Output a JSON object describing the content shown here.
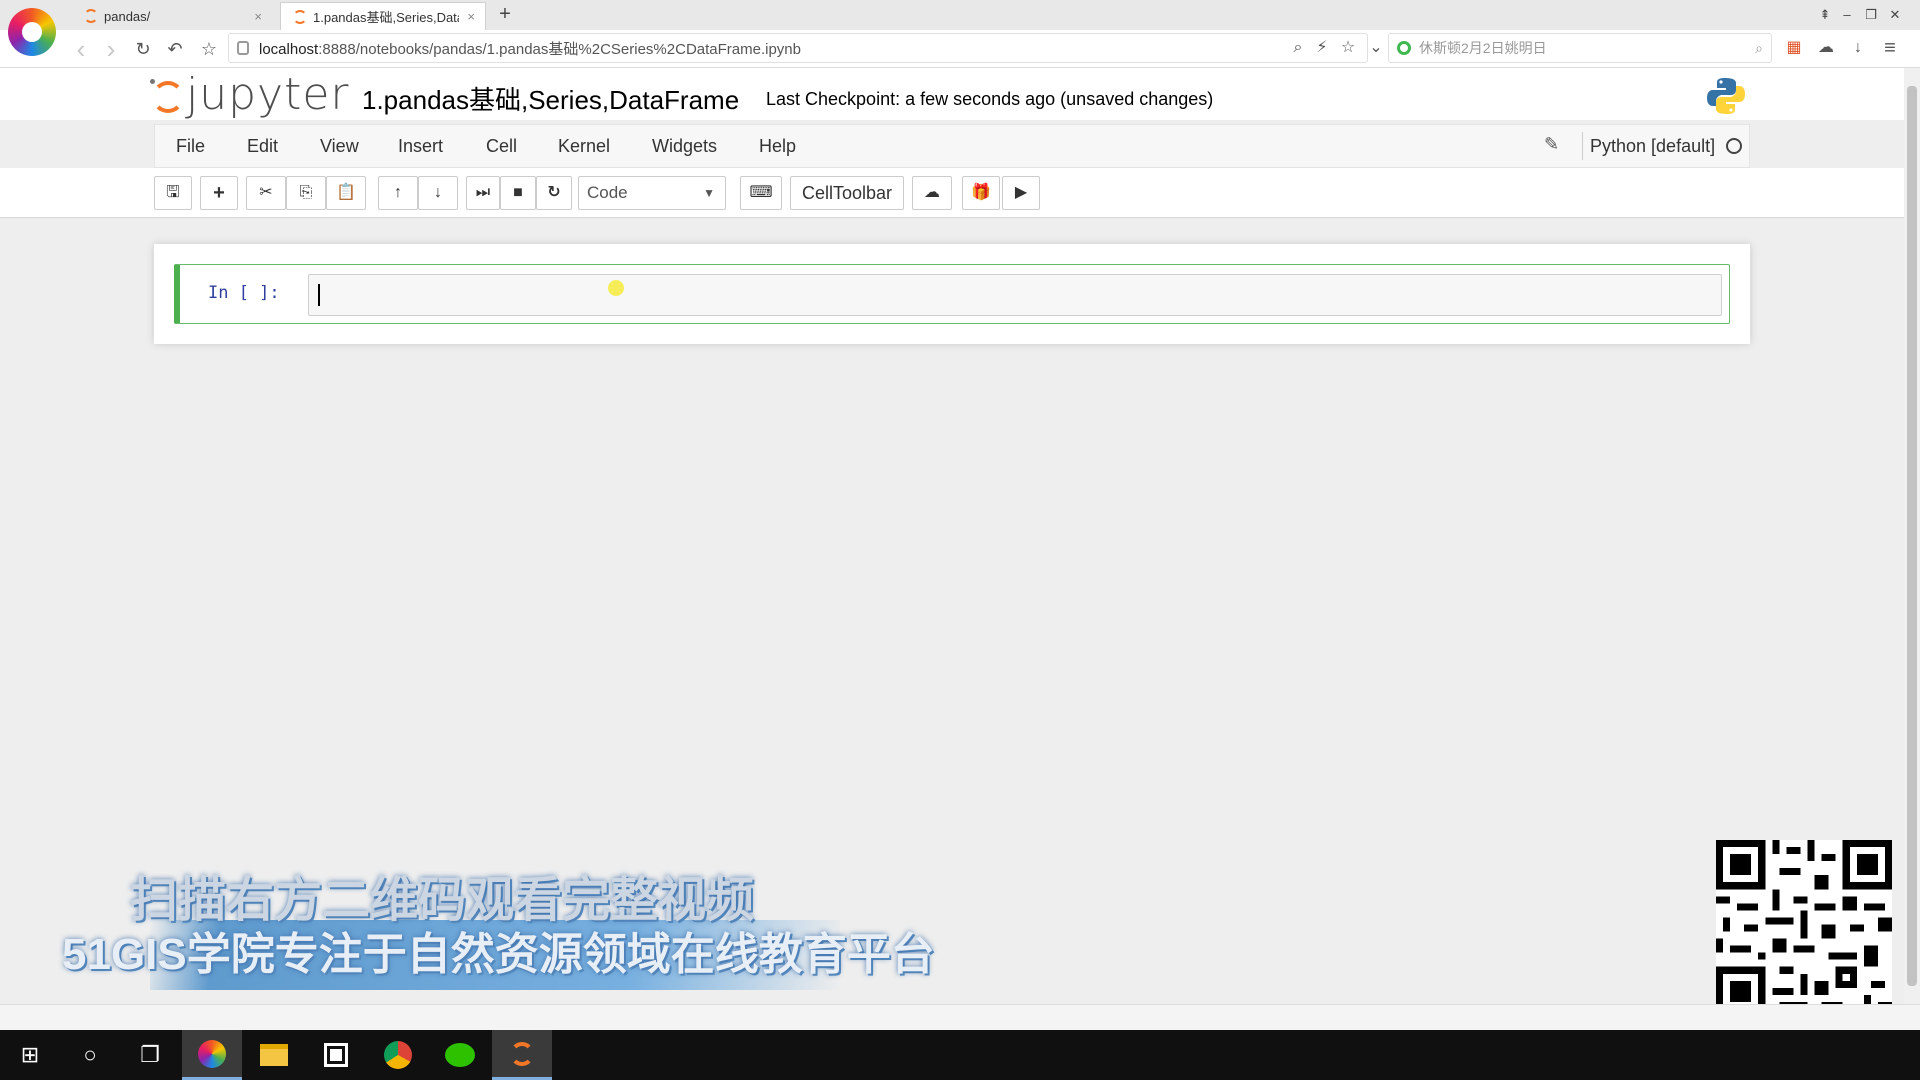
{
  "browser": {
    "tabs": [
      {
        "title": "pandas/",
        "close": "×"
      },
      {
        "title": "1.pandas基础,Series,Data",
        "close": "×"
      }
    ],
    "new_tab": "+",
    "nav": {
      "back": "‹",
      "forward": "›",
      "reload": "↻",
      "undo": "↶",
      "star": "☆"
    },
    "address": {
      "host": "localhost",
      "rest": ":8888/notebooks/pandas/1.pandas基础%2CSeries%2CDataFrame.ipynb"
    },
    "address_icons": {
      "zoom": "⌕",
      "flash": "⚡",
      "bookmark": "☆",
      "dropdown": "⌄"
    },
    "search": {
      "placeholder": "休斯顿2月2日姚明日",
      "mag": "⌕"
    },
    "right_icons": {
      "apps": "▦",
      "cloud": "☁",
      "download": "↓",
      "menu": "≡"
    },
    "window_controls": {
      "pin": "⇞",
      "minimize": "–",
      "restore": "❐",
      "close": "✕"
    }
  },
  "jupyter": {
    "logo_text": "jupyter",
    "notebook_title": "1.pandas基础,Series,DataFrame",
    "checkpoint": "Last Checkpoint: a few seconds ago (unsaved changes)",
    "menu": [
      "File",
      "Edit",
      "View",
      "Insert",
      "Cell",
      "Kernel",
      "Widgets",
      "Help"
    ],
    "edit_icon": "✎",
    "kernel_name": "Python [default]",
    "toolbar": {
      "save": "🖫",
      "add": "+",
      "cut": "✂",
      "copy": "⎘",
      "paste": "📋",
      "up": "↑",
      "down": "↓",
      "run": "⏭",
      "stop": "■",
      "restart": "↻",
      "celltype": "Code",
      "celltype_arrow": "▼",
      "keyboard": "⌨",
      "celltoolbar": "CellToolbar",
      "upload": "☁",
      "gift": "🎁",
      "video": "▶"
    },
    "cell": {
      "prompt": "In [ ]:"
    }
  },
  "overlay": {
    "line1": "扫描右方二维码观看完整视频",
    "line2": "51GIS学院专注于自然资源领域在线教育平台"
  },
  "taskbar": {
    "start": "⊞",
    "search": "○",
    "taskview": "❐",
    "apps": [
      "browser-icon",
      "file-explorer-icon",
      "store-icon",
      "chrome-icon",
      "wechat-icon",
      "jupyter-icon"
    ]
  }
}
